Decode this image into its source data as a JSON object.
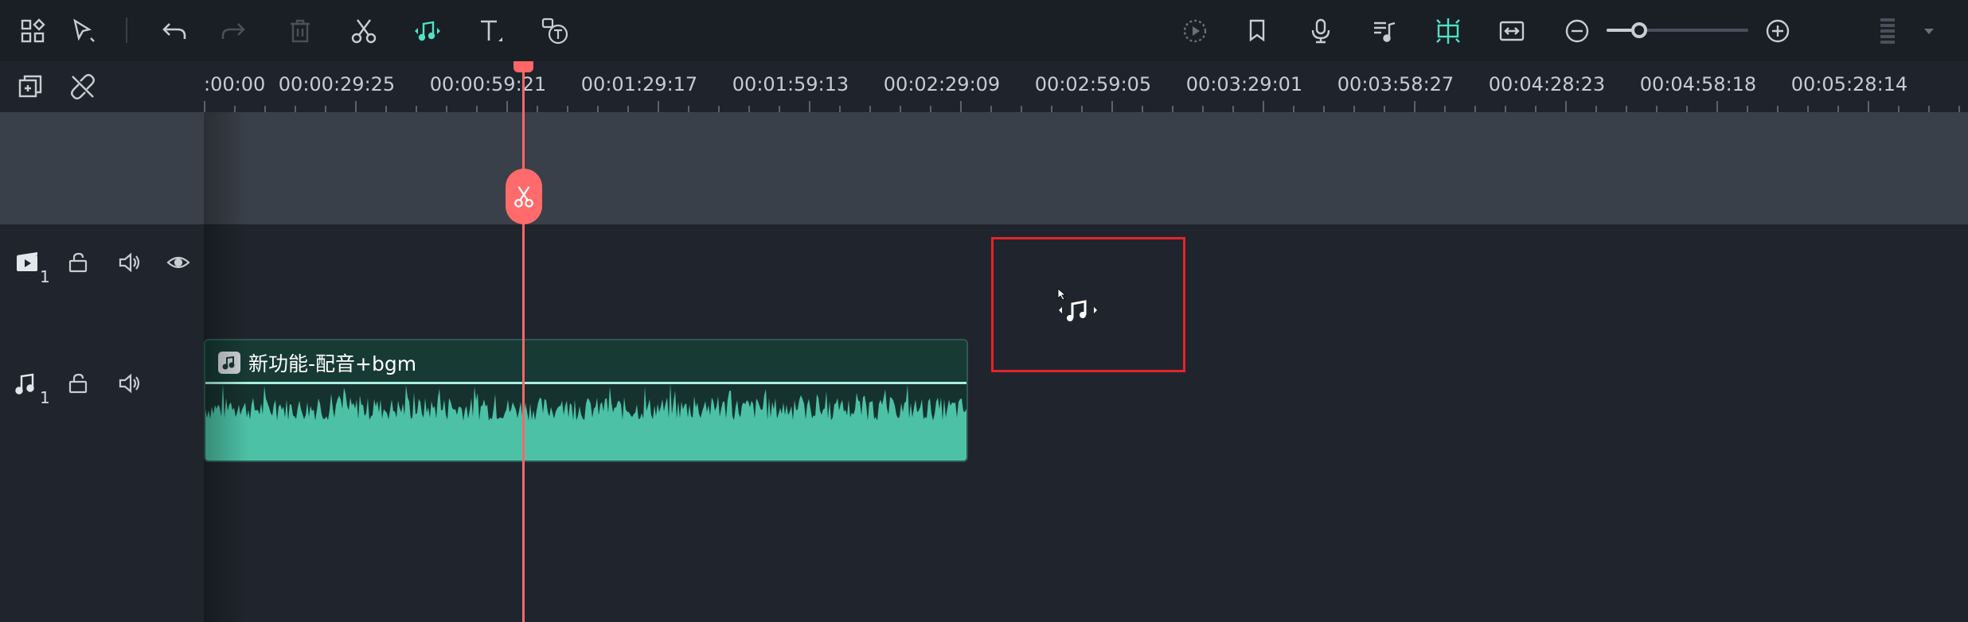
{
  "toolbar": {
    "left_icons": [
      "layout-icon",
      "select-arrow-icon",
      "undo-icon",
      "redo-icon",
      "delete-icon",
      "scissors-icon",
      "audio-stretch-icon",
      "text-icon",
      "speech-to-text-icon"
    ],
    "right_icons": [
      "render-preview-icon",
      "marker-icon",
      "microphone-icon",
      "audio-mix-icon",
      "snap-icon",
      "fit-icon",
      "zoom-out-icon",
      "zoom-in-icon",
      "track-settings-icon"
    ],
    "zoom_level": 0.23,
    "active_color": "#4de3c5"
  },
  "ruler": {
    "labels": [
      ":00:00",
      "00:00:29:25",
      "00:00:59:21",
      "00:01:29:17",
      "00:01:59:13",
      "00:02:29:09",
      "00:02:59:05",
      "00:03:29:01",
      "00:03:58:27",
      "00:04:28:23",
      "00:04:58:18",
      "00:05:28:14"
    ]
  },
  "tracks": {
    "video": {
      "icon": "video-track-icon",
      "number": "1"
    },
    "audio": {
      "icon": "music-track-icon",
      "number": "1"
    }
  },
  "clip": {
    "title": "新功能-配音+bgm",
    "icon": "music-note-icon",
    "wave_color": "#4cc1a6",
    "header_color": "#173a34"
  },
  "playhead": {
    "color": "#ff6767"
  },
  "drop_target": {
    "border_color": "#e2242b",
    "icon": "music-drag-icon"
  }
}
